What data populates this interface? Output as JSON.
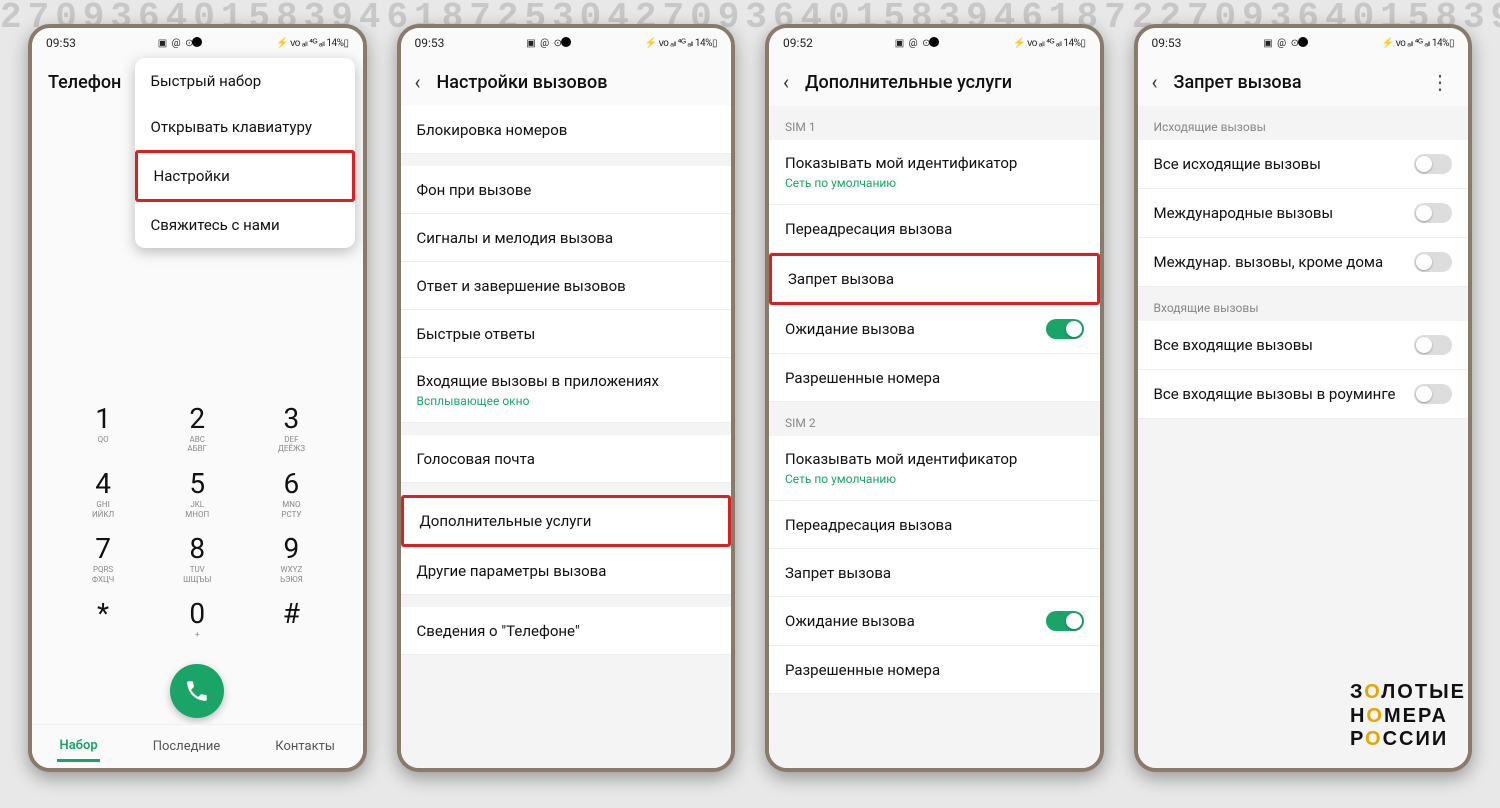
{
  "background_digits": "270936401583946187253042709364015839461872",
  "statusbar": {
    "time1": "09:53",
    "time2": "09:52",
    "icons_left": "▣ @ ⊙",
    "right_text": "⚡ ᴠᴏ ₐₗₗ ⁴ᴳ ₐₗₗ 14%▯"
  },
  "screen1": {
    "title": "Телефон",
    "menu": [
      "Быстрый набор",
      "Открывать клавиатуру",
      "Настройки",
      "Свяжитесь с нами"
    ],
    "highlight_index": 2,
    "tabs": [
      "Набор",
      "Последние",
      "Контакты"
    ],
    "active_tab": 0,
    "keys": [
      {
        "d": "1",
        "l": "QO"
      },
      {
        "d": "2",
        "l": "ABC\nАБВГ"
      },
      {
        "d": "3",
        "l": "DEF\nДЕЁЖЗ"
      },
      {
        "d": "4",
        "l": "GHI\nИЙКЛ"
      },
      {
        "d": "5",
        "l": "JKL\nМНОП"
      },
      {
        "d": "6",
        "l": "MNO\nРСТУ"
      },
      {
        "d": "7",
        "l": "PQRS\nФХЦЧ"
      },
      {
        "d": "8",
        "l": "TUV\nШЩЪЫ"
      },
      {
        "d": "9",
        "l": "WXYZ\nЬЭЮЯ"
      },
      {
        "d": "*",
        "l": ""
      },
      {
        "d": "0",
        "l": "+"
      },
      {
        "d": "#",
        "l": ""
      }
    ]
  },
  "screen2": {
    "title": "Настройки вызовов",
    "groups": [
      [
        "Блокировка номеров"
      ],
      [
        "Фон при вызове",
        "Сигналы и мелодия вызова",
        "Ответ и завершение вызовов",
        "Быстрые ответы",
        {
          "label": "Входящие вызовы в приложениях",
          "sub": "Всплывающее окно"
        }
      ],
      [
        "Голосовая почта"
      ],
      [
        "Дополнительные услуги",
        "Другие параметры вызова"
      ],
      [
        "Сведения о \"Телефоне\""
      ]
    ],
    "highlight": "Дополнительные услуги"
  },
  "screen3": {
    "title": "Дополнительные услуги",
    "sim1_header": "SIM 1",
    "sim2_header": "SIM 2",
    "sim_items": [
      {
        "label": "Показывать мой идентификатор",
        "sub": "Сеть по умолчанию"
      },
      {
        "label": "Переадресация вызова"
      },
      {
        "label": "Запрет вызова"
      },
      {
        "label": "Ожидание вызова",
        "toggle": true
      },
      {
        "label": "Разрешенные номера"
      }
    ],
    "highlight": "Запрет вызова"
  },
  "screen4": {
    "title": "Запрет вызова",
    "outgoing_header": "Исходящие вызовы",
    "incoming_header": "Входящие вызовы",
    "outgoing": [
      "Все исходящие вызовы",
      "Международные вызовы",
      "Междунар. вызовы, кроме дома"
    ],
    "incoming": [
      "Все входящие вызовы",
      "Все входящие вызовы в роуминге"
    ]
  },
  "brand": {
    "l1_a": "З",
    "l1_o": "О",
    "l1_b": "ЛОТЫЕ",
    "l2_a": "Н",
    "l2_o": "О",
    "l2_b": "МЕРА",
    "l3_a": "Р",
    "l3_o": "О",
    "l3_b": "ССИИ"
  }
}
